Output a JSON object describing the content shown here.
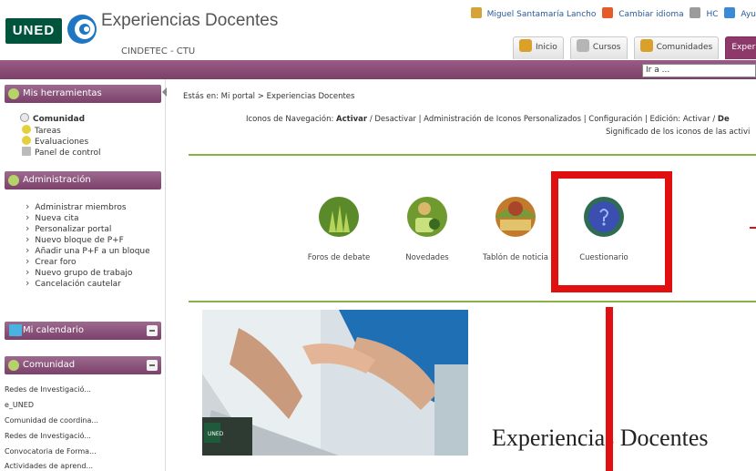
{
  "header": {
    "logo_text": "UNED",
    "title": "Experiencias Docentes",
    "subtitle": "CINDETEC - CTU",
    "user_name": "Miguel Santamaría Lancho",
    "change_language": "Cambiar idioma",
    "hc": "HC",
    "help": "Ayu"
  },
  "tabs": [
    {
      "label": "Inicio",
      "active": false
    },
    {
      "label": "Cursos",
      "active": false
    },
    {
      "label": "Comunidades",
      "active": false
    },
    {
      "label": "Experie",
      "active": true
    }
  ],
  "goto": {
    "value": "Ir a ..."
  },
  "sidebar": {
    "tools": {
      "title": "Mis herramientas",
      "items": [
        "Comunidad",
        "Tareas",
        "Evaluaciones",
        "Panel de control"
      ]
    },
    "admin": {
      "title": "Administración",
      "items": [
        "Administrar miembros",
        "Nueva cita",
        "Personalizar portal",
        "Nuevo bloque de P+F",
        "Añadir una P+F a un bloque",
        "Crear foro",
        "Nuevo grupo de trabajo",
        "Cancelación cautelar"
      ]
    },
    "calendar": {
      "title": "Mi calendario"
    },
    "community": {
      "title": "Comunidad",
      "items": [
        "Redes de Investigació...",
        "e_UNED",
        "Comunidad de coordina...",
        "Redes de Investigació...",
        "Convocatoria de Forma...",
        "Actividades de aprend..."
      ]
    }
  },
  "main": {
    "breadcrumb": "Estás en: Mi portal > Experiencias Docentes",
    "nav_icons_label": "Iconos de Navegación:",
    "nav_activate": "Activar",
    "nav_rest": "/ Desactivar | Administración de Iconos Personalizados | Configuración | Edición: Activar /",
    "nav_trailing": "De",
    "activity_icons": "Significado de los iconos de las activi",
    "tools": [
      {
        "label": "Foros de debate",
        "color": "#5a8a2a"
      },
      {
        "label": "Novedades",
        "color": "#6e9a30"
      },
      {
        "label": "Tablón de noticia",
        "color": "#c27a2c"
      },
      {
        "label": "Cuestionario",
        "color": "#2f6d52"
      }
    ],
    "hero_title": "Experiencias Docentes",
    "hero_badge": "UNED"
  },
  "colors": {
    "accent": "#8d3a6a",
    "highlight": "#e01010",
    "rule": "#8ab143"
  }
}
